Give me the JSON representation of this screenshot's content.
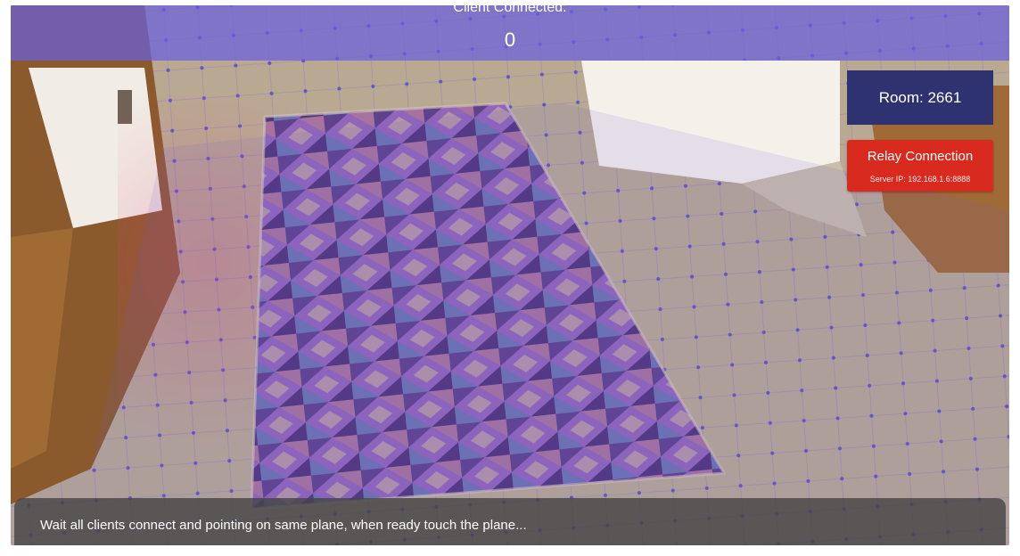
{
  "status": {
    "clients_label": "Client Connected:",
    "clients_count": "0"
  },
  "room": {
    "label": "Room: 2661"
  },
  "relay": {
    "button_label": "Relay Connection",
    "server_ip": "Server IP: 192.168.1.6:8888"
  },
  "instruction": {
    "message": "Wait all clients connect and pointing on same plane, when ready touch the plane..."
  },
  "colors": {
    "top_bar": "#695fdc",
    "room_box": "#2e3271",
    "relay_button": "#d92a1f",
    "plane_overlay": "#6e5bd6",
    "plane_points": "#3b2fe0"
  }
}
